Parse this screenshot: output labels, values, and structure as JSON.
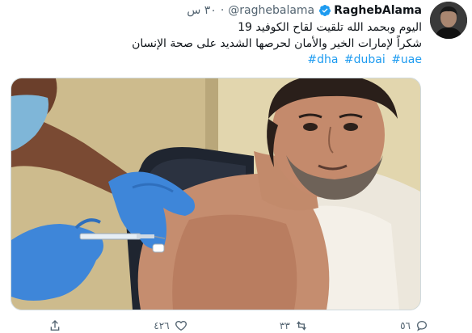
{
  "tweet": {
    "display_name": "RaghebAlama",
    "handle": "@raghebalama",
    "time": "٣٠ س",
    "separator": "·",
    "text_line_1": "اليوم وبحمد الله تلقيت لقاح الكوفيد 19",
    "text_line_2": "شكراً لإمارات الخير والأمان لحرصها الشديد على صحة الإنسان",
    "hashtags": [
      "#dha",
      "#dubai",
      "#uae"
    ],
    "verified_color": "#1d9bf0",
    "link_color": "#1d9bf0"
  },
  "actions": {
    "reply_count": "٥٦",
    "retweet_count": "٣٣",
    "like_count": "٤٢٦",
    "icons": [
      "reply-icon",
      "retweet-icon",
      "like-icon",
      "share-icon"
    ]
  }
}
